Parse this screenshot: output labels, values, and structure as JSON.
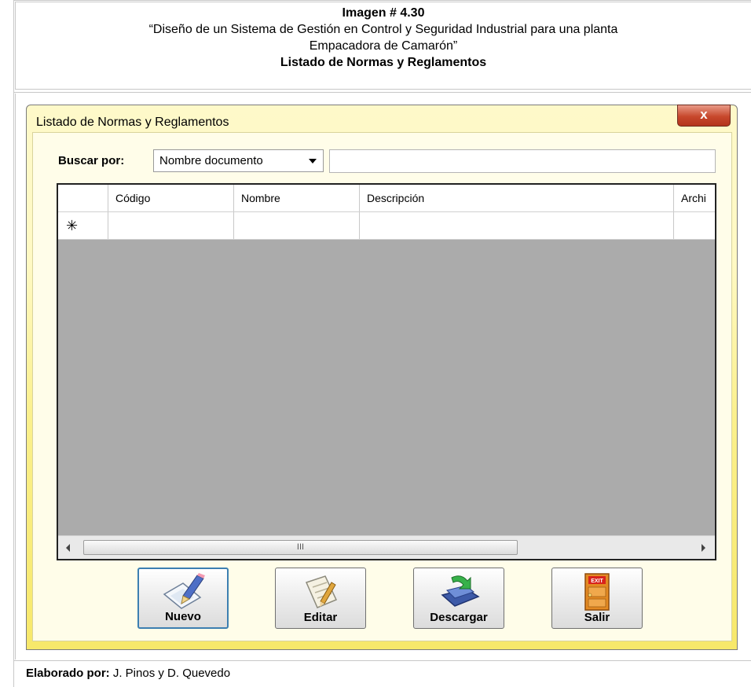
{
  "caption": {
    "heading": "Imagen # 4.30",
    "subtitle_line1": "“Diseño de un Sistema de Gestión en Control y Seguridad Industrial para una planta",
    "subtitle_line2": "Empacadora de Camarón”",
    "title": "Listado de Normas y Reglamentos"
  },
  "window": {
    "title": "Listado de Normas y Reglamentos",
    "close_label": "x"
  },
  "search": {
    "label": "Buscar por:",
    "selected_option": "Nombre documento",
    "input_value": ""
  },
  "grid": {
    "columns": [
      "Código",
      "Nombre",
      "Descripción",
      "Archi"
    ],
    "new_row_marker": "✳",
    "scrollbar_grip": "III"
  },
  "buttons": {
    "nuevo": "Nuevo",
    "editar": "Editar",
    "descargar": "Descargar",
    "salir": "Salir",
    "exit_sign": "EXIT"
  },
  "footer": {
    "label": "Elaborado por:",
    "authors": " J. Pinos y D. Quevedo"
  },
  "colors": {
    "window_gradient_top": "#fef9c9",
    "window_gradient_bottom": "#f7e86a",
    "grid_background": "#ababab",
    "close_button": "#c7482c",
    "primary_button_border": "#3c7fb1"
  }
}
